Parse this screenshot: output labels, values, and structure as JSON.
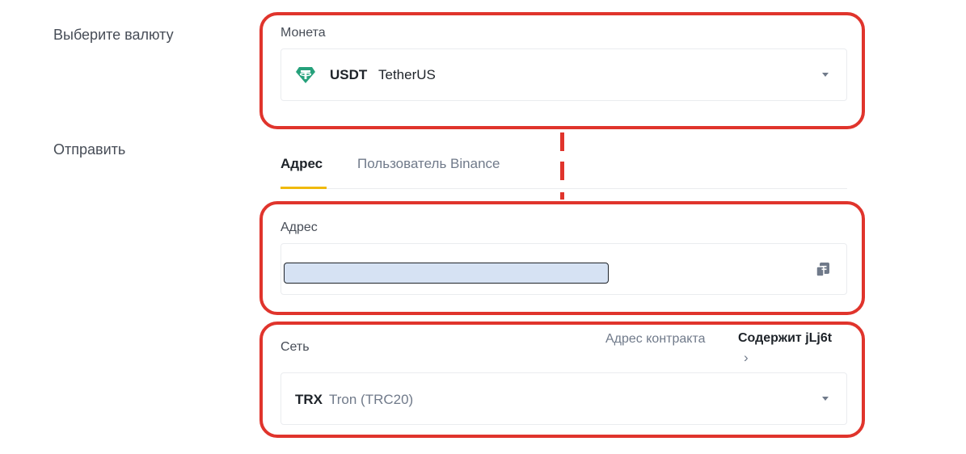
{
  "form": {
    "select_currency_label": "Выберите валюту",
    "send_label": "Отправить"
  },
  "coin": {
    "label": "Монета",
    "icon": "tether-icon",
    "icon_color": "#26a17b",
    "symbol": "USDT",
    "name": "TetherUS"
  },
  "send_tabs": [
    {
      "label": "Адрес",
      "active": true
    },
    {
      "label": "Пользователь Binance",
      "active": false
    }
  ],
  "address": {
    "label": "Адрес",
    "value_redacted": true,
    "paste_icon": "paste-icon"
  },
  "network": {
    "label": "Сеть",
    "contract_link_label": "Адрес контракта",
    "contract_value": "Содержит jLj6t",
    "contract_chevron": "›",
    "symbol": "TRX",
    "name": "Tron (TRC20)"
  },
  "colors": {
    "accent_tab": "#f0b90b",
    "highlight": "#e0342c",
    "redaction_fill": "#d6e2f3"
  }
}
